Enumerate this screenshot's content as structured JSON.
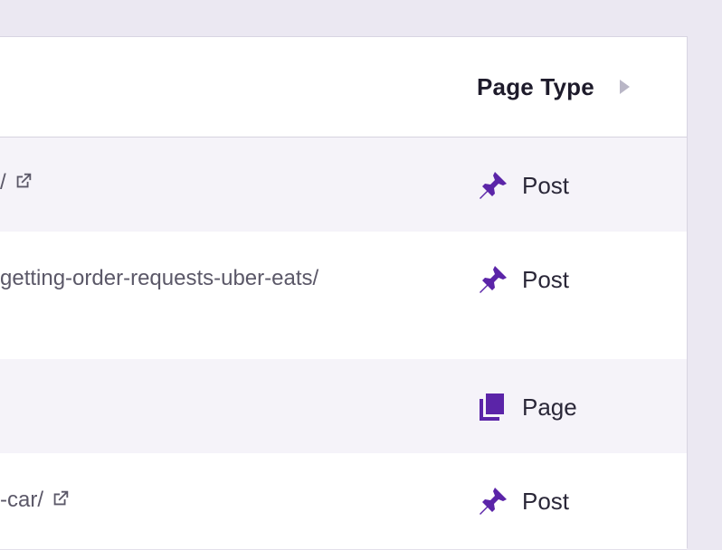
{
  "colors": {
    "accent": "#5b24a8",
    "header_text": "#1e1b2b",
    "row_text": "#2a2738",
    "url_text": "#5b5868",
    "sort_arrow": "#b9b6c6"
  },
  "table": {
    "header": {
      "page_type_label": "Page Type"
    },
    "rows": [
      {
        "url_fragment": "/",
        "type_label": "Post",
        "type_icon": "pushpin-icon",
        "has_external_link": true
      },
      {
        "url_fragment": "getting-order-requests-uber-eats/",
        "type_label": "Post",
        "type_icon": "pushpin-icon",
        "has_external_link": false
      },
      {
        "url_fragment": "",
        "type_label": "Page",
        "type_icon": "pages-icon",
        "has_external_link": false
      },
      {
        "url_fragment": "-car/",
        "type_label": "Post",
        "type_icon": "pushpin-icon",
        "has_external_link": true
      }
    ]
  }
}
